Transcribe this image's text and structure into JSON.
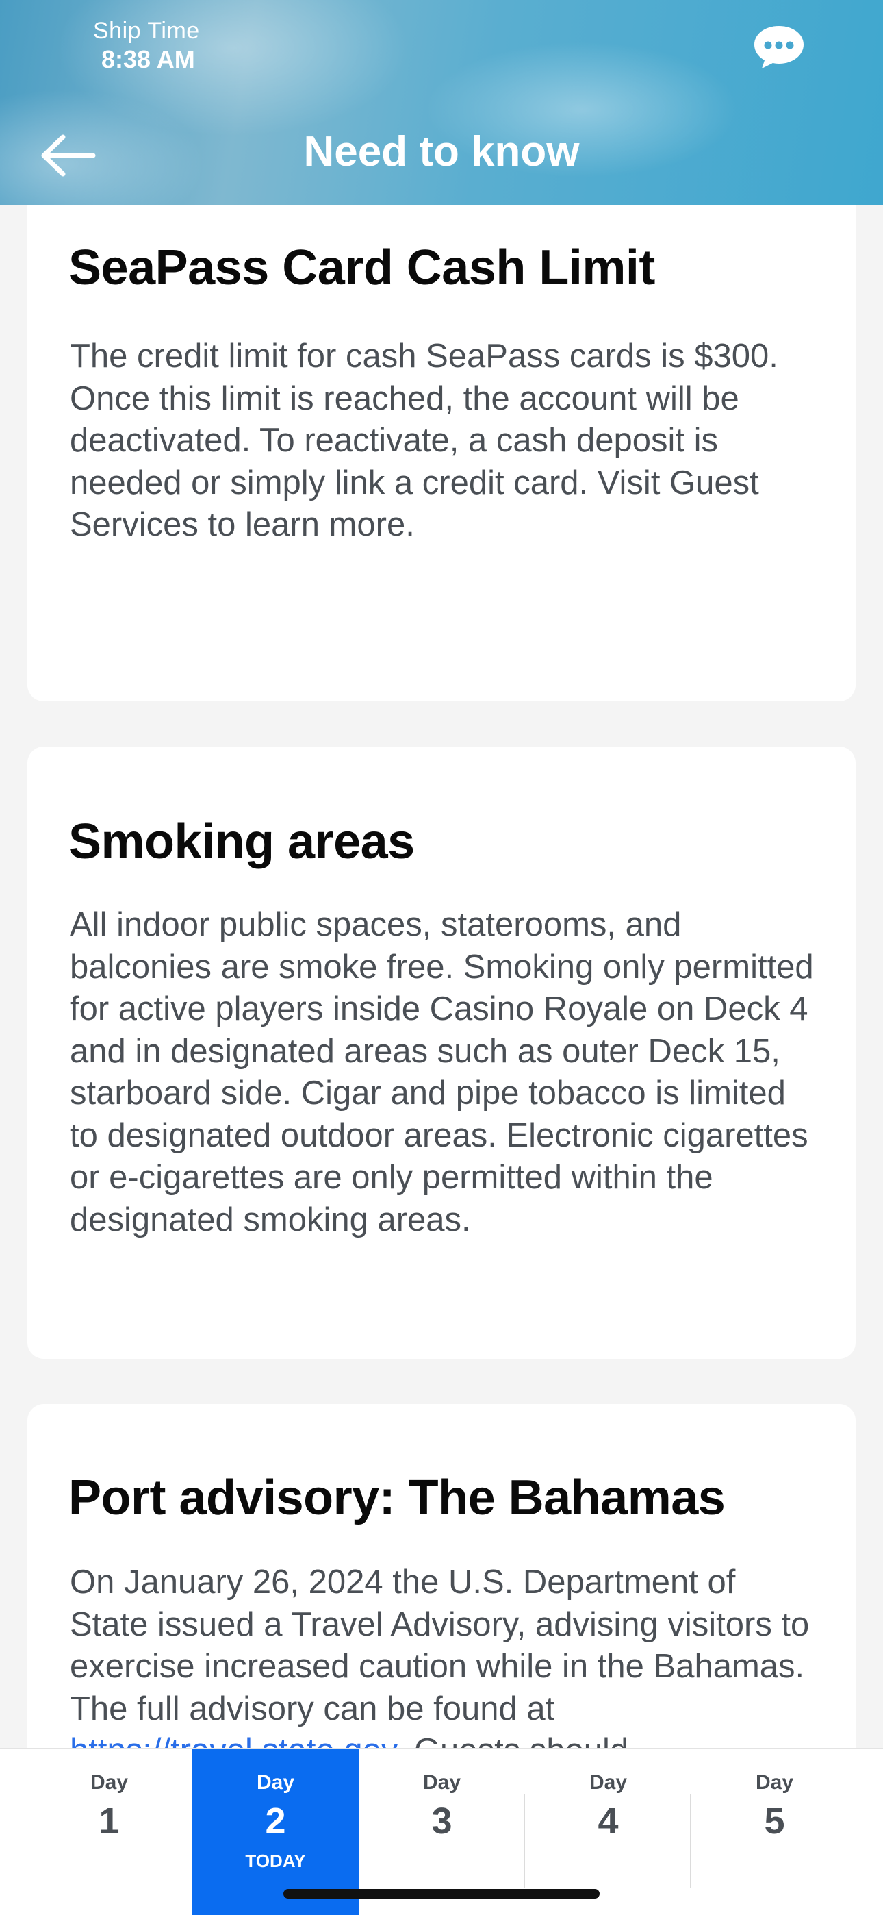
{
  "header": {
    "ship_time_label": "Ship Time",
    "ship_time_value": "8:38 AM",
    "title": "Need to know",
    "back_icon": "arrow-left-icon",
    "chat_icon": "chat-bubble-icon"
  },
  "cards": [
    {
      "title": "SeaPass Card Cash Limit",
      "body": "The credit limit for cash SeaPass cards is $300. Once this limit is reached, the account will be deactivated. To reactivate, a cash deposit is needed or simply link a credit card. Visit Guest Services to learn more."
    },
    {
      "title": "Smoking areas",
      "body": "All indoor public spaces, staterooms, and balconies are smoke free. Smoking only permitted for active players inside Casino Royale on Deck 4 and in designated areas such as outer Deck 15, starboard side. Cigar and pipe tobacco is limited to designated outdoor areas. Electronic cigarettes or e-cigarettes are only permitted within the designated smoking areas."
    },
    {
      "title": "Port advisory: The Bahamas",
      "body": "On January 26, 2024 the U.S. Department of State issued a Travel Advisory, advising visitors to exercise increased caution while in the Bahamas. The full advisory can be found at",
      "link_text": "https://travel.state.gov",
      "body_after": ". Guests should"
    }
  ],
  "days": {
    "tabs": [
      {
        "label": "Day",
        "number": "1"
      },
      {
        "label": "Day",
        "number": "2",
        "sublabel": "TODAY"
      },
      {
        "label": "Day",
        "number": "3"
      },
      {
        "label": "Day",
        "number": "4"
      },
      {
        "label": "Day",
        "number": "5"
      }
    ],
    "active_index": 1,
    "active_color": "#0a6cf0"
  }
}
